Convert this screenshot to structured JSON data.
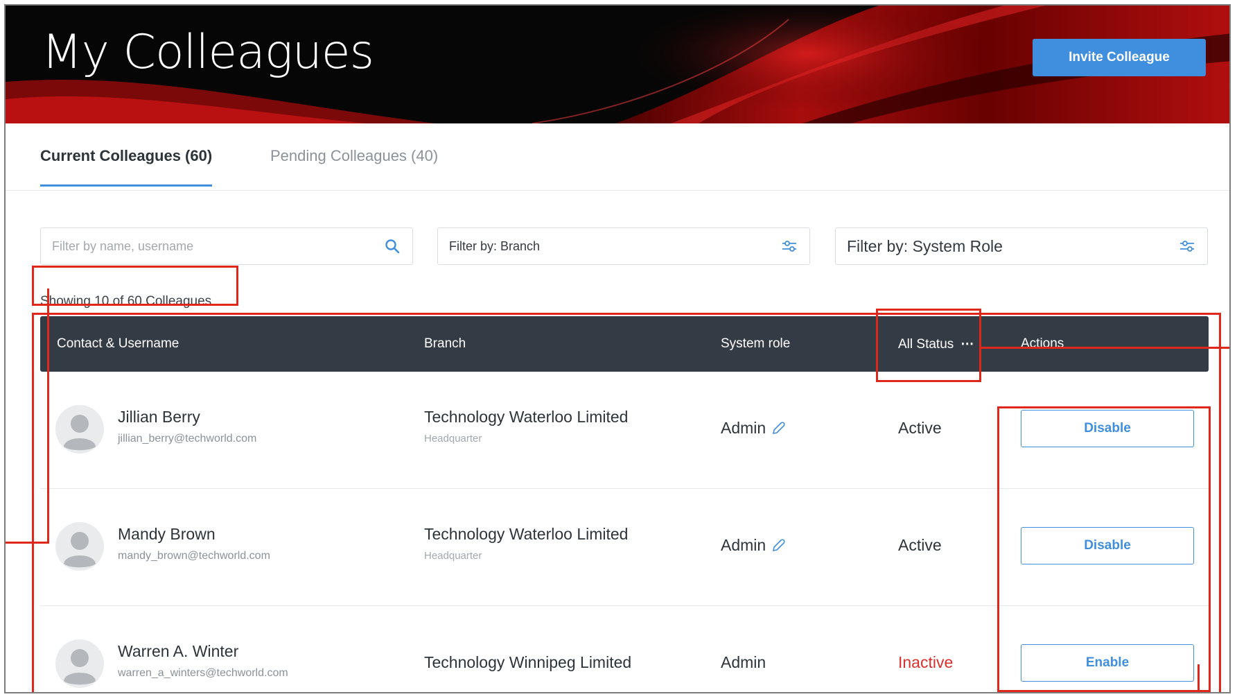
{
  "header": {
    "title": "My Colleagues",
    "invite_label": "Invite Colleague"
  },
  "tabs": [
    {
      "label": "Current Colleagues (60)",
      "active": true
    },
    {
      "label": "Pending Colleagues (40)",
      "active": false
    }
  ],
  "filters": {
    "search_placeholder": "Filter by name, username",
    "branch_label": "Filter by: Branch",
    "role_label": "Filter by: System Role"
  },
  "showing_text": "Showing 10 of 60 Colleagues",
  "table": {
    "columns": [
      "Contact & Username",
      "Branch",
      "System role",
      "All Status",
      "Actions"
    ],
    "rows": [
      {
        "name": "Jillian Berry",
        "email": "jillian_berry@techworld.com",
        "branch": "Technology Waterloo Limited",
        "branch_sub": "Headquarter",
        "role": "Admin",
        "role_editable": true,
        "status": "Active",
        "action": "Disable"
      },
      {
        "name": "Mandy Brown",
        "email": "mandy_brown@techworld.com",
        "branch": "Technology Waterloo Limited",
        "branch_sub": "Headquarter",
        "role": "Admin",
        "role_editable": true,
        "status": "Active",
        "action": "Disable"
      },
      {
        "name": "Warren A. Winter",
        "email": "warren_a_winters@techworld.com",
        "branch": "Technology Winnipeg Limited",
        "branch_sub": "",
        "role": "Admin",
        "role_editable": false,
        "status": "Inactive",
        "action": "Enable"
      }
    ]
  },
  "colors": {
    "accent": "#3f8fde",
    "header_bg": "#333c45",
    "inactive": "#d9302e",
    "annotation": "#e0271c"
  },
  "icons": {
    "search": "search-icon",
    "filter": "sliders-icon",
    "edit": "pencil-icon",
    "more": "more-horizontal-icon",
    "avatar": "user-avatar-icon"
  }
}
